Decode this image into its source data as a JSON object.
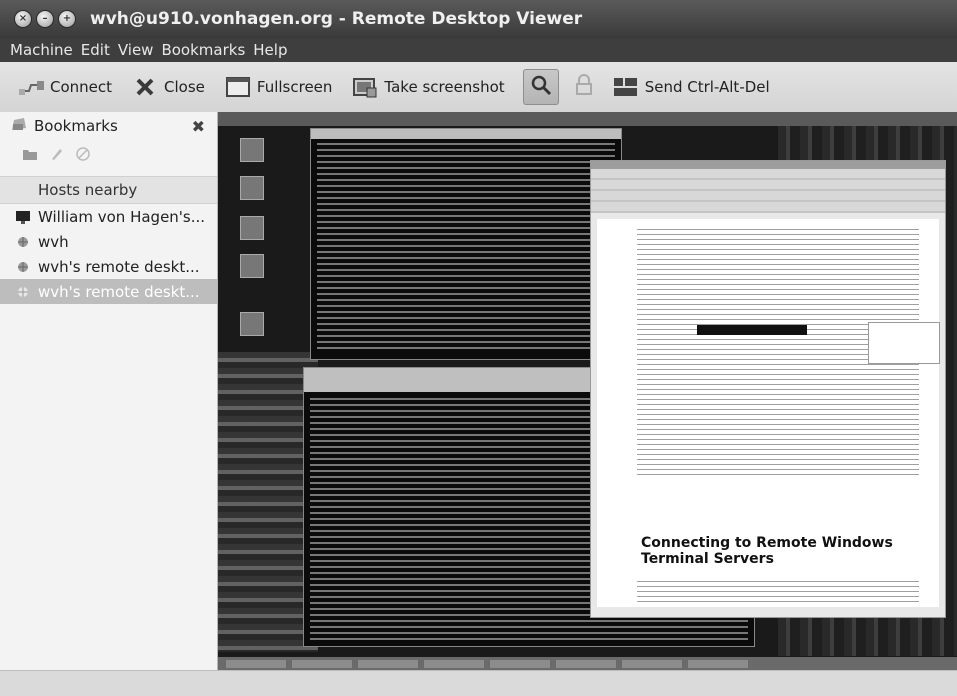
{
  "window": {
    "title": "wvh@u910.vonhagen.org - Remote Desktop Viewer"
  },
  "menubar": {
    "items": [
      "Machine",
      "Edit",
      "View",
      "Bookmarks",
      "Help"
    ]
  },
  "toolbar": {
    "connect_label": "Connect",
    "close_label": "Close",
    "fullscreen_label": "Fullscreen",
    "screenshot_label": "Take screenshot",
    "ctrl_alt_del_label": "Send Ctrl-Alt-Del"
  },
  "sidebar": {
    "title": "Bookmarks",
    "section_label": "Hosts nearby",
    "items": [
      {
        "label": "William von Hagen's...",
        "icon": "monitor-icon"
      },
      {
        "label": "wvh",
        "icon": "network-icon"
      },
      {
        "label": "wvh's remote deskt...",
        "icon": "network-icon"
      },
      {
        "label": "wvh's remote deskt...",
        "icon": "network-icon",
        "selected": true
      }
    ]
  },
  "remote": {
    "doc_heading": "Connecting to Remote Windows Terminal Servers"
  },
  "colors": {
    "titlebar": "#4a4a4a",
    "menubar": "#3e3e3e",
    "selection": "#bdbdbd"
  }
}
